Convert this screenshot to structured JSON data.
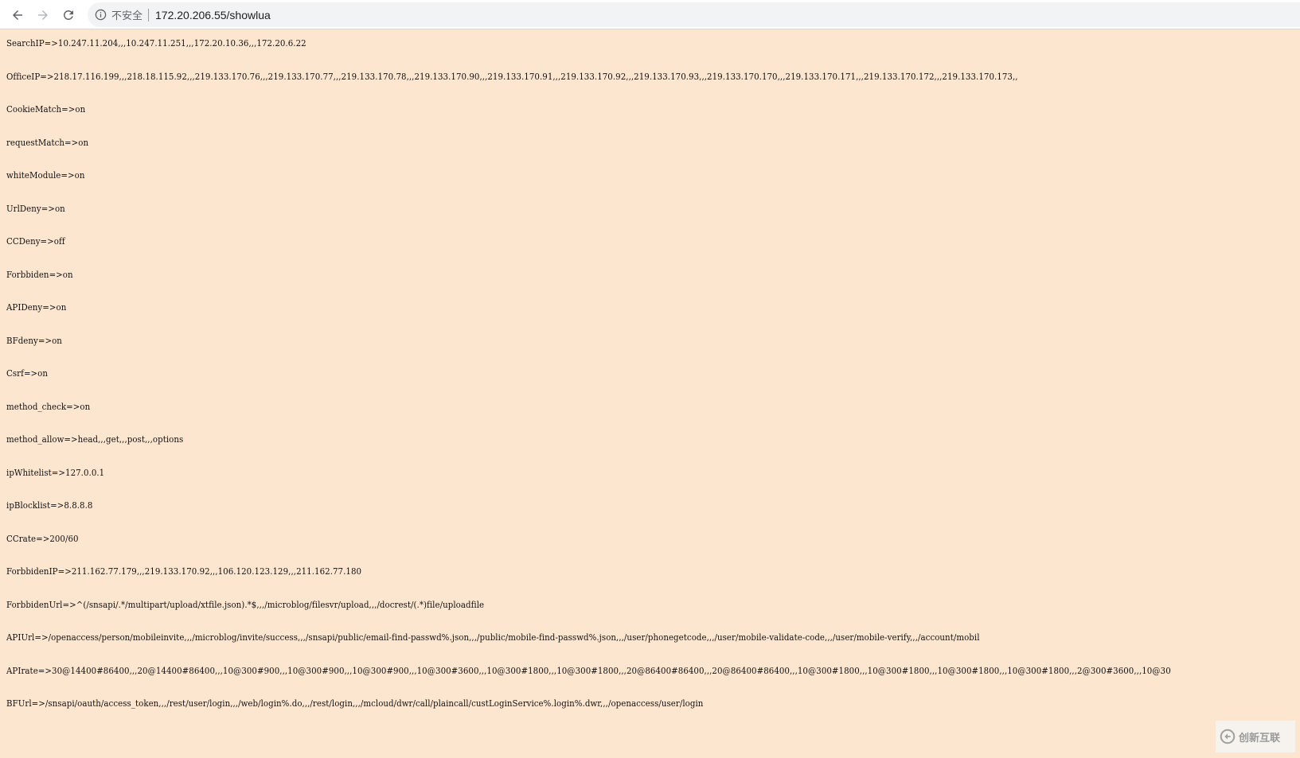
{
  "browser": {
    "security_label": "不安全",
    "url": "172.20.206.55/showlua"
  },
  "config_lines": [
    "SearchIP=>10.247.11.204,,,10.247.11.251,,,172.20.10.36,,,172.20.6.22",
    "OfficeIP=>218.17.116.199,,,218.18.115.92,,,219.133.170.76,,,219.133.170.77,,,219.133.170.78,,,219.133.170.90,,,219.133.170.91,,,219.133.170.92,,,219.133.170.93,,,219.133.170.170,,,219.133.170.171,,,219.133.170.172,,,219.133.170.173,,",
    "CookieMatch=>on",
    "requestMatch=>on",
    "whiteModule=>on",
    "UrlDeny=>on",
    "CCDeny=>off",
    "Forbbiden=>on",
    "APIDeny=>on",
    "BFdeny=>on",
    "Csrf=>on",
    "method_check=>on",
    "method_allow=>head,,,get,,,post,,,options",
    "ipWhitelist=>127.0.0.1",
    "ipBlocklist=>8.8.8.8",
    "CCrate=>200/60",
    "ForbbidenIP=>211.162.77.179,,,219.133.170.92,,,106.120.123.129,,,211.162.77.180",
    "ForbbidenUrl=>^(/snsapi/.*/multipart/upload/xtfile.json).*$,,,/microblog/filesvr/upload,,,/docrest/(.*)file/uploadfile",
    "APIUrl=>/openaccess/person/mobileinvite,,,/microblog/invite/success,,,/snsapi/public/email-find-passwd%.json,,,/public/mobile-find-passwd%.json,,,/user/phonegetcode,,,/user/mobile-validate-code,,,/user/mobile-verify,,,/account/mobil",
    "APIrate=>30@14400#86400,,,20@14400#86400,,,10@300#900,,,10@300#900,,,10@300#900,,,10@300#3600,,,10@300#1800,,,10@300#1800,,,20@86400#86400,,,20@86400#86400,,,10@300#1800,,,10@300#1800,,,10@300#1800,,,10@300#1800,,,2@300#3600,,,10@30",
    "BFUrl=>/snsapi/oauth/access_token,,,/rest/user/login,,,/web/login%.do,,,/rest/login,,,/mcloud/dwr/call/plaincall/custLoginService%.login%.dwr,,,/openaccess/user/login"
  ],
  "watermark": {
    "text": "创新互联"
  },
  "colors": {
    "page_background": "#fde6d0",
    "text": "#111111",
    "toolbar_background": "#ffffff",
    "omnibox_background": "#f1f3f4"
  },
  "icons": [
    "back-arrow-icon",
    "forward-arrow-icon",
    "reload-icon",
    "info-icon",
    "watermark-logo-icon"
  ]
}
